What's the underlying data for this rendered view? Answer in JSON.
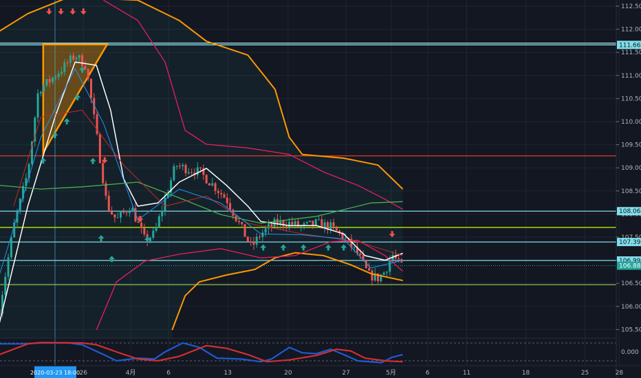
{
  "chart_data": {
    "type": "candlestick",
    "instrument_quote": "USD/JPY style price chart",
    "y_axis": {
      "min": 105.3,
      "max": 112.65,
      "ticks": [
        "112.500",
        "112.000",
        "111.500",
        "111.000",
        "110.500",
        "110.000",
        "109.500",
        "109.000",
        "108.500",
        "108.000",
        "107.500",
        "107.000",
        "106.500",
        "106.000",
        "105.500"
      ],
      "tick_values": [
        112.5,
        112,
        111.5,
        111,
        110.5,
        110,
        109.5,
        109,
        108.5,
        108,
        107.5,
        107,
        106.5,
        106,
        105.5
      ]
    },
    "x_axis": {
      "unit": "trading days from 2020-03-23",
      "labels": [
        {
          "t": 0,
          "text": "2020-03-23   18:00",
          "highlight": true
        },
        {
          "t": 2.4,
          "text": "26"
        },
        {
          "t": 6.4,
          "text": "4月"
        },
        {
          "t": 9.6,
          "text": "6"
        },
        {
          "t": 14.6,
          "text": "13"
        },
        {
          "t": 19.7,
          "text": "20"
        },
        {
          "t": 24.6,
          "text": "27"
        },
        {
          "t": 28.4,
          "text": "5月"
        },
        {
          "t": 31.5,
          "text": "6"
        },
        {
          "t": 34.8,
          "text": "11"
        },
        {
          "t": 39.8,
          "text": "18"
        },
        {
          "t": 44.8,
          "text": "25"
        },
        {
          "t": 47.7,
          "text": "28"
        }
      ]
    },
    "price_close_path": [
      [
        -4.7,
        105.94
      ],
      [
        -3.5,
        107.72
      ],
      [
        -2.3,
        108.91
      ],
      [
        -1.4,
        110.7
      ],
      [
        -0.6,
        110.85
      ],
      [
        0.6,
        111.15
      ],
      [
        1.7,
        111.44
      ],
      [
        2.6,
        111.22
      ],
      [
        3.2,
        110.25
      ],
      [
        3.8,
        109.21
      ],
      [
        4.4,
        108.17
      ],
      [
        5.2,
        107.87
      ],
      [
        6.4,
        108.17
      ],
      [
        7.6,
        107.43
      ],
      [
        8.4,
        107.57
      ],
      [
        9.3,
        108.32
      ],
      [
        10.2,
        109.06
      ],
      [
        11.0,
        108.99
      ],
      [
        12.2,
        108.91
      ],
      [
        13.4,
        108.62
      ],
      [
        14.5,
        108.32
      ],
      [
        15.7,
        107.72
      ],
      [
        16.6,
        107.28
      ],
      [
        17.4,
        107.57
      ],
      [
        18.6,
        107.8
      ],
      [
        19.8,
        107.8
      ],
      [
        20.9,
        107.72
      ],
      [
        22.1,
        107.8
      ],
      [
        23.3,
        107.72
      ],
      [
        24.4,
        107.5
      ],
      [
        25.6,
        107.13
      ],
      [
        26.5,
        106.68
      ],
      [
        27.3,
        106.61
      ],
      [
        27.9,
        106.76
      ],
      [
        28.5,
        107.13
      ],
      [
        29.1,
        106.9
      ],
      [
        29.4,
        106.88
      ]
    ],
    "series": [
      {
        "name": "bollinger-outer-upper",
        "color": "#ff9800",
        "width": 2,
        "points": [
          [
            -4.7,
            111.96
          ],
          [
            -2.3,
            112.34
          ],
          [
            1.2,
            112.7
          ],
          [
            7.0,
            112.63
          ],
          [
            10.5,
            112.19
          ],
          [
            12.8,
            111.74
          ],
          [
            16.3,
            111.44
          ],
          [
            18.6,
            110.7
          ],
          [
            19.8,
            109.66
          ],
          [
            20.9,
            109.29
          ],
          [
            24.4,
            109.21
          ],
          [
            27.3,
            109.06
          ],
          [
            29.4,
            108.54
          ]
        ]
      },
      {
        "name": "bollinger-outer-lower",
        "color": "#ff9800",
        "width": 2,
        "points": [
          [
            9.9,
            105.49
          ],
          [
            11.0,
            106.23
          ],
          [
            12.2,
            106.53
          ],
          [
            14.5,
            106.68
          ],
          [
            16.9,
            106.8
          ],
          [
            18.6,
            107.05
          ],
          [
            20.3,
            107.16
          ],
          [
            22.7,
            107.1
          ],
          [
            25.0,
            106.9
          ],
          [
            26.7,
            106.71
          ],
          [
            29.4,
            106.56
          ]
        ]
      },
      {
        "name": "bollinger-inner-upper",
        "color": "#e91e63",
        "width": 1.3,
        "points": [
          [
            4.1,
            112.63
          ],
          [
            7.0,
            112.19
          ],
          [
            9.3,
            111.29
          ],
          [
            11.0,
            109.81
          ],
          [
            12.8,
            109.51
          ],
          [
            16.3,
            109.43
          ],
          [
            19.8,
            109.29
          ],
          [
            22.7,
            108.91
          ],
          [
            25.6,
            108.62
          ],
          [
            27.9,
            108.32
          ],
          [
            29.4,
            108.1
          ]
        ]
      },
      {
        "name": "bollinger-inner-lower",
        "color": "#e91e63",
        "width": 1.3,
        "points": [
          [
            3.5,
            105.49
          ],
          [
            5.2,
            106.53
          ],
          [
            7.6,
            106.98
          ],
          [
            10.5,
            107.13
          ],
          [
            14.0,
            107.25
          ],
          [
            17.4,
            107.05
          ],
          [
            20.3,
            107.1
          ],
          [
            23.3,
            107.4
          ],
          [
            25.6,
            107.43
          ],
          [
            27.9,
            107.1
          ],
          [
            29.4,
            106.76
          ]
        ]
      },
      {
        "name": "ma-white",
        "color": "#ffffff",
        "width": 1.5,
        "points": [
          [
            -4.7,
            105.64
          ],
          [
            -2.3,
            108.17
          ],
          [
            0,
            110.1
          ],
          [
            1.7,
            111.29
          ],
          [
            3.5,
            111.22
          ],
          [
            4.7,
            110.25
          ],
          [
            5.8,
            108.76
          ],
          [
            7.0,
            108.17
          ],
          [
            8.7,
            108.24
          ],
          [
            10.5,
            108.69
          ],
          [
            12.8,
            108.99
          ],
          [
            14.5,
            108.62
          ],
          [
            16.3,
            108.17
          ],
          [
            17.4,
            107.84
          ],
          [
            19.8,
            107.75
          ],
          [
            22.1,
            107.75
          ],
          [
            24.4,
            107.57
          ],
          [
            26.2,
            107.1
          ],
          [
            27.9,
            107.0
          ],
          [
            29.4,
            107.15
          ]
        ]
      },
      {
        "name": "ma-green",
        "color": "#4caf50",
        "width": 1.3,
        "points": [
          [
            -4.7,
            108.62
          ],
          [
            -1.2,
            108.54
          ],
          [
            2.3,
            108.59
          ],
          [
            7.0,
            108.69
          ],
          [
            10.5,
            108.35
          ],
          [
            14.0,
            107.99
          ],
          [
            17.4,
            107.8
          ],
          [
            22.1,
            107.95
          ],
          [
            26.7,
            108.24
          ],
          [
            29.4,
            108.27
          ]
        ]
      },
      {
        "name": "ma-red",
        "color": "#c62828",
        "width": 1,
        "points": [
          [
            -3.5,
            108.17
          ],
          [
            -1.2,
            110.1
          ],
          [
            2.3,
            110.25
          ],
          [
            5.8,
            109.06
          ],
          [
            9.3,
            108.17
          ],
          [
            12.8,
            108.39
          ],
          [
            16.3,
            107.8
          ],
          [
            20.9,
            107.57
          ],
          [
            25.6,
            107.4
          ],
          [
            29.4,
            107.1
          ]
        ]
      },
      {
        "name": "ma-blue",
        "color": "#2196f3",
        "width": 1,
        "points": [
          [
            -4.7,
            106.68
          ],
          [
            -1.2,
            109.66
          ],
          [
            1.7,
            111.15
          ],
          [
            4.1,
            109.96
          ],
          [
            7.0,
            107.87
          ],
          [
            10.5,
            108.54
          ],
          [
            14.0,
            108.24
          ],
          [
            17.4,
            107.57
          ],
          [
            20.9,
            107.55
          ],
          [
            24.4,
            107.46
          ],
          [
            26.7,
            106.83
          ],
          [
            29.4,
            107.0
          ]
        ]
      }
    ],
    "horizontal_levels": [
      {
        "price": 111.7,
        "color": "#b2ebf2"
      },
      {
        "price": 111.662,
        "color": "#80deea",
        "label": "111.662"
      },
      {
        "price": 109.26,
        "color": "#e53935"
      },
      {
        "price": 108.062,
        "color": "#80deea",
        "label": "108.062"
      },
      {
        "price": 107.71,
        "color": "#c6ff00"
      },
      {
        "price": 107.394,
        "color": "#80deea",
        "label": "107.394"
      },
      {
        "price": 106.994,
        "color": "#80deea",
        "label": "106.994"
      },
      {
        "price": 106.47,
        "color": "#8bc34a"
      }
    ],
    "last_price": {
      "price": 106.882,
      "label": "106.882",
      "color": "#26a69a"
    },
    "triangle": {
      "points": [
        [
          -1.0,
          111.67
        ],
        [
          4.4,
          111.67
        ],
        [
          -1.0,
          109.33
        ]
      ],
      "color": "#ff9800"
    },
    "signals_sell": [
      [
        -0.5,
        112.36
      ],
      [
        0.5,
        112.36
      ],
      [
        1.5,
        112.36
      ],
      [
        2.4,
        112.36
      ],
      [
        4.2,
        109.14
      ],
      [
        7.2,
        107.87
      ],
      [
        28.5,
        107.54
      ]
    ],
    "signals_buy": [
      [
        -1.0,
        109.18
      ],
      [
        0,
        109.73
      ],
      [
        1.0,
        110.03
      ],
      [
        1.9,
        110.55
      ],
      [
        2.3,
        111.15
      ],
      [
        3.2,
        109.17
      ],
      [
        3.9,
        107.5
      ],
      [
        4.8,
        107.05
      ],
      [
        7.8,
        107.47
      ],
      [
        17.6,
        107.3
      ],
      [
        19.3,
        107.3
      ],
      [
        21.0,
        107.3
      ],
      [
        23.1,
        107.3
      ],
      [
        24.4,
        107.3
      ]
    ],
    "oscillator": {
      "zero_label": "0.000",
      "range": [
        -1.5,
        1.5
      ],
      "levels": [
        1,
        -1
      ],
      "series": [
        {
          "name": "osc-blue",
          "color": "#1e5bd1",
          "points": [
            [
              -4.7,
              0.9
            ],
            [
              -2.9,
              0.9
            ],
            [
              -1.2,
              1.0
            ],
            [
              1.2,
              1.0
            ],
            [
              2.3,
              0.8
            ],
            [
              4.1,
              -0.3
            ],
            [
              5.2,
              -1.0
            ],
            [
              7.0,
              -0.7
            ],
            [
              8.4,
              -0.8
            ],
            [
              9.3,
              0
            ],
            [
              10.8,
              1.0
            ],
            [
              12.2,
              0.5
            ],
            [
              13.7,
              -0.7
            ],
            [
              15.7,
              -0.8
            ],
            [
              17.4,
              -1.1
            ],
            [
              18.3,
              -0.8
            ],
            [
              19.8,
              0.5
            ],
            [
              20.9,
              -0.1
            ],
            [
              22.1,
              -0.2
            ],
            [
              23.3,
              0.3
            ],
            [
              24.4,
              -0.3
            ],
            [
              25.6,
              -1.0
            ],
            [
              27.6,
              -1.2
            ],
            [
              28.5,
              -0.6
            ],
            [
              29.4,
              -0.3
            ]
          ]
        },
        {
          "name": "osc-red",
          "color": "#d32f2f",
          "points": [
            [
              -4.7,
              -0.3
            ],
            [
              -2.3,
              0.9
            ],
            [
              -1.2,
              1.05
            ],
            [
              2.3,
              1.0
            ],
            [
              3.5,
              0.8
            ],
            [
              5.2,
              0
            ],
            [
              7.0,
              -0.8
            ],
            [
              8.7,
              -1.0
            ],
            [
              10.5,
              -0.5
            ],
            [
              12.8,
              0.7
            ],
            [
              14.5,
              0.4
            ],
            [
              16.3,
              -0.3
            ],
            [
              17.9,
              -1.1
            ],
            [
              19.8,
              -0.9
            ],
            [
              22.1,
              -0.4
            ],
            [
              23.8,
              0.3
            ],
            [
              25.0,
              0.1
            ],
            [
              26.2,
              -0.7
            ],
            [
              27.9,
              -1.0
            ],
            [
              29.4,
              -1.1
            ]
          ]
        }
      ]
    },
    "colors": {
      "background": "#131722",
      "up": "#26a69a",
      "down": "#ef5350",
      "grid": "#1f2533",
      "axis_text": "#b2b5be",
      "crosshair_label": "#2196f3"
    }
  }
}
